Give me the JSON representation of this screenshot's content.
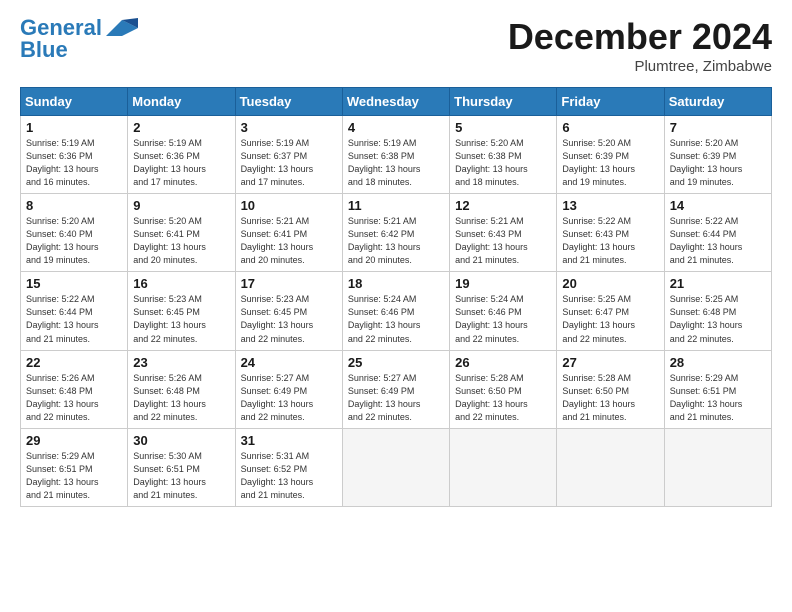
{
  "header": {
    "logo_line1": "General",
    "logo_line2": "Blue",
    "month_title": "December 2024",
    "location": "Plumtree, Zimbabwe"
  },
  "days_of_week": [
    "Sunday",
    "Monday",
    "Tuesday",
    "Wednesday",
    "Thursday",
    "Friday",
    "Saturday"
  ],
  "weeks": [
    [
      {
        "day": "1",
        "info": "Sunrise: 5:19 AM\nSunset: 6:36 PM\nDaylight: 13 hours\nand 16 minutes."
      },
      {
        "day": "2",
        "info": "Sunrise: 5:19 AM\nSunset: 6:36 PM\nDaylight: 13 hours\nand 17 minutes."
      },
      {
        "day": "3",
        "info": "Sunrise: 5:19 AM\nSunset: 6:37 PM\nDaylight: 13 hours\nand 17 minutes."
      },
      {
        "day": "4",
        "info": "Sunrise: 5:19 AM\nSunset: 6:38 PM\nDaylight: 13 hours\nand 18 minutes."
      },
      {
        "day": "5",
        "info": "Sunrise: 5:20 AM\nSunset: 6:38 PM\nDaylight: 13 hours\nand 18 minutes."
      },
      {
        "day": "6",
        "info": "Sunrise: 5:20 AM\nSunset: 6:39 PM\nDaylight: 13 hours\nand 19 minutes."
      },
      {
        "day": "7",
        "info": "Sunrise: 5:20 AM\nSunset: 6:39 PM\nDaylight: 13 hours\nand 19 minutes."
      }
    ],
    [
      {
        "day": "8",
        "info": "Sunrise: 5:20 AM\nSunset: 6:40 PM\nDaylight: 13 hours\nand 19 minutes."
      },
      {
        "day": "9",
        "info": "Sunrise: 5:20 AM\nSunset: 6:41 PM\nDaylight: 13 hours\nand 20 minutes."
      },
      {
        "day": "10",
        "info": "Sunrise: 5:21 AM\nSunset: 6:41 PM\nDaylight: 13 hours\nand 20 minutes."
      },
      {
        "day": "11",
        "info": "Sunrise: 5:21 AM\nSunset: 6:42 PM\nDaylight: 13 hours\nand 20 minutes."
      },
      {
        "day": "12",
        "info": "Sunrise: 5:21 AM\nSunset: 6:43 PM\nDaylight: 13 hours\nand 21 minutes."
      },
      {
        "day": "13",
        "info": "Sunrise: 5:22 AM\nSunset: 6:43 PM\nDaylight: 13 hours\nand 21 minutes."
      },
      {
        "day": "14",
        "info": "Sunrise: 5:22 AM\nSunset: 6:44 PM\nDaylight: 13 hours\nand 21 minutes."
      }
    ],
    [
      {
        "day": "15",
        "info": "Sunrise: 5:22 AM\nSunset: 6:44 PM\nDaylight: 13 hours\nand 21 minutes."
      },
      {
        "day": "16",
        "info": "Sunrise: 5:23 AM\nSunset: 6:45 PM\nDaylight: 13 hours\nand 22 minutes."
      },
      {
        "day": "17",
        "info": "Sunrise: 5:23 AM\nSunset: 6:45 PM\nDaylight: 13 hours\nand 22 minutes."
      },
      {
        "day": "18",
        "info": "Sunrise: 5:24 AM\nSunset: 6:46 PM\nDaylight: 13 hours\nand 22 minutes."
      },
      {
        "day": "19",
        "info": "Sunrise: 5:24 AM\nSunset: 6:46 PM\nDaylight: 13 hours\nand 22 minutes."
      },
      {
        "day": "20",
        "info": "Sunrise: 5:25 AM\nSunset: 6:47 PM\nDaylight: 13 hours\nand 22 minutes."
      },
      {
        "day": "21",
        "info": "Sunrise: 5:25 AM\nSunset: 6:48 PM\nDaylight: 13 hours\nand 22 minutes."
      }
    ],
    [
      {
        "day": "22",
        "info": "Sunrise: 5:26 AM\nSunset: 6:48 PM\nDaylight: 13 hours\nand 22 minutes."
      },
      {
        "day": "23",
        "info": "Sunrise: 5:26 AM\nSunset: 6:48 PM\nDaylight: 13 hours\nand 22 minutes."
      },
      {
        "day": "24",
        "info": "Sunrise: 5:27 AM\nSunset: 6:49 PM\nDaylight: 13 hours\nand 22 minutes."
      },
      {
        "day": "25",
        "info": "Sunrise: 5:27 AM\nSunset: 6:49 PM\nDaylight: 13 hours\nand 22 minutes."
      },
      {
        "day": "26",
        "info": "Sunrise: 5:28 AM\nSunset: 6:50 PM\nDaylight: 13 hours\nand 22 minutes."
      },
      {
        "day": "27",
        "info": "Sunrise: 5:28 AM\nSunset: 6:50 PM\nDaylight: 13 hours\nand 21 minutes."
      },
      {
        "day": "28",
        "info": "Sunrise: 5:29 AM\nSunset: 6:51 PM\nDaylight: 13 hours\nand 21 minutes."
      }
    ],
    [
      {
        "day": "29",
        "info": "Sunrise: 5:29 AM\nSunset: 6:51 PM\nDaylight: 13 hours\nand 21 minutes."
      },
      {
        "day": "30",
        "info": "Sunrise: 5:30 AM\nSunset: 6:51 PM\nDaylight: 13 hours\nand 21 minutes."
      },
      {
        "day": "31",
        "info": "Sunrise: 5:31 AM\nSunset: 6:52 PM\nDaylight: 13 hours\nand 21 minutes."
      },
      {
        "day": "",
        "info": ""
      },
      {
        "day": "",
        "info": ""
      },
      {
        "day": "",
        "info": ""
      },
      {
        "day": "",
        "info": ""
      }
    ]
  ]
}
